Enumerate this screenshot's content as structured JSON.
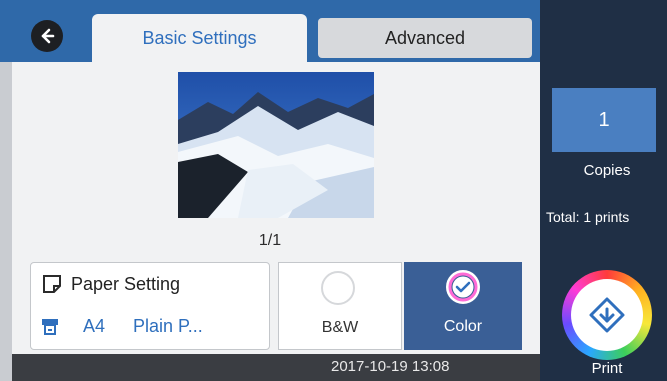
{
  "tabs": {
    "basic": "Basic Settings",
    "advanced": "Advanced"
  },
  "preview": {
    "page_count": "1/1"
  },
  "paper": {
    "title": "Paper Setting",
    "size": "A4",
    "type": "Plain P..."
  },
  "color_mode": {
    "bw": "B&W",
    "color": "Color",
    "selected": "Color"
  },
  "status": {
    "datetime": "2017-10-19 13:08"
  },
  "copies": {
    "value": "1",
    "label": "Copies",
    "total": "Total: 1 prints"
  },
  "print": {
    "label": "Print"
  },
  "colors": {
    "tab_accent": "#2f6fbd",
    "topbar": "#2f69a9",
    "right_panel": "#1f2f45",
    "selected_color_btn": "#3a5f96"
  },
  "icons": {
    "back": "back-arrow-icon",
    "paper": "paper-setting-icon",
    "tray": "paper-tray-icon",
    "color_selected": "check-icon",
    "print": "start-diamond-icon"
  }
}
